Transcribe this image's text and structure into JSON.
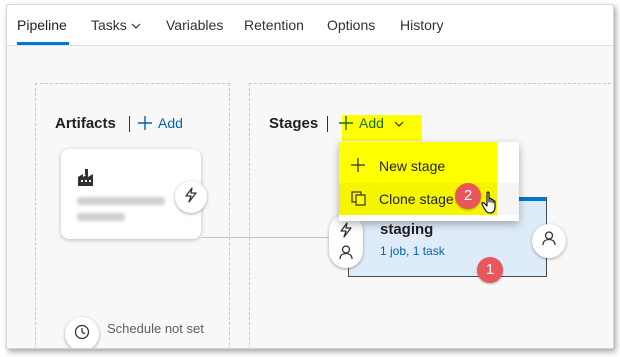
{
  "tabs": [
    {
      "label": "Pipeline",
      "active": true
    },
    {
      "label": "Tasks",
      "has_dropdown": true
    },
    {
      "label": "Variables"
    },
    {
      "label": "Retention"
    },
    {
      "label": "Options"
    },
    {
      "label": "History"
    }
  ],
  "artifacts": {
    "title": "Artifacts",
    "add_label": "Add",
    "card_icon": "build-artifact-icon",
    "trigger_icon": "lightning-icon",
    "schedule_label": "Schedule not set"
  },
  "stages": {
    "title": "Stages",
    "add_label": "Add",
    "menu": [
      {
        "label": "New stage",
        "icon": "plus-icon"
      },
      {
        "label": "Clone stage",
        "icon": "clone-icon"
      }
    ],
    "stage": {
      "name": "staging",
      "summary": "1 job, 1 task"
    }
  },
  "annotations": {
    "badge_1": "1",
    "badge_2": "2"
  },
  "colors": {
    "accent": "#0078d4",
    "link": "#0064b5",
    "highlight": "#ffff00",
    "badge": "#e8585a",
    "stage_bg": "#deecf9"
  }
}
